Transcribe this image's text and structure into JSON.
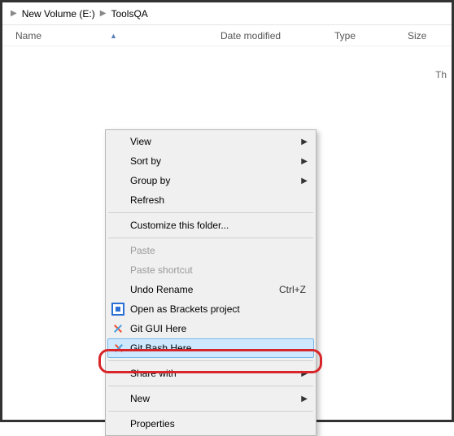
{
  "breadcrumb": {
    "items": [
      "New Volume (E:)",
      "ToolsQA"
    ]
  },
  "columns": {
    "name": "Name",
    "date": "Date modified",
    "type": "Type",
    "size": "Size"
  },
  "empty_hint": "Th",
  "menu": {
    "view": "View",
    "sort_by": "Sort by",
    "group_by": "Group by",
    "refresh": "Refresh",
    "customize": "Customize this folder...",
    "paste": "Paste",
    "paste_shortcut": "Paste shortcut",
    "undo_rename": "Undo Rename",
    "undo_shortcut": "Ctrl+Z",
    "open_brackets": "Open as Brackets project",
    "git_gui": "Git GUI Here",
    "git_bash": "Git Bash Here",
    "share_with": "Share with",
    "new": "New",
    "properties": "Properties"
  }
}
